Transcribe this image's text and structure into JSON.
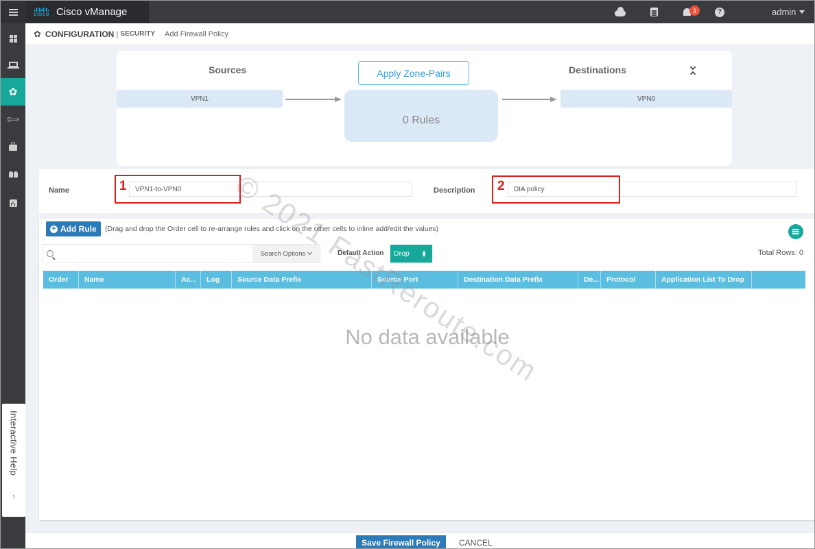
{
  "app": {
    "title": "Cisco vManage",
    "logo_text": "cisco",
    "user": "admin",
    "notification_count": "3",
    "icons": [
      "menu-icon",
      "cloud-icon",
      "clipboard-icon",
      "bell-icon",
      "help-icon"
    ]
  },
  "nav": {
    "items": [
      {
        "name": "dashboard",
        "icon": "grid-icon",
        "active": false
      },
      {
        "name": "monitor",
        "icon": "laptop-icon",
        "active": false
      },
      {
        "name": "configuration",
        "icon": "gear-icon",
        "active": true
      },
      {
        "name": "tools",
        "icon": "wrench-icon",
        "active": false
      },
      {
        "name": "maintenance",
        "icon": "briefcase-icon",
        "active": false
      },
      {
        "name": "administration",
        "icon": "users-icon",
        "active": false
      },
      {
        "name": "analytics",
        "icon": "chart-icon",
        "active": false
      }
    ],
    "help_tab": "Interactive Help",
    "help_chevron": "›"
  },
  "header": {
    "section": "CONFIGURATION",
    "separator": "|",
    "subsection": "SECURITY",
    "page": "Add Firewall Policy"
  },
  "zone": {
    "sources_label": "Sources",
    "destinations_label": "Destinations",
    "apply_button": "Apply Zone-Pairs",
    "source": "VPN1",
    "destination": "VPN0",
    "rules": "0 Rules"
  },
  "form": {
    "name_label": "Name",
    "name_value": "VPN1-to-VPN0",
    "description_label": "Description",
    "description_value": "DIA policy",
    "callout_1": "1",
    "callout_2": "2"
  },
  "rules": {
    "add_button": "Add Rule",
    "hint": "(Drag and drop the Order cell to re-arrange rules and click on the other cells to inline add/edit the values)",
    "search_placeholder": "",
    "search_options": "Search Options",
    "default_action_label": "Default Action",
    "default_action_value": "Drop",
    "total_rows": "Total Rows: 0",
    "columns": [
      "Order",
      "Name",
      "Ac...",
      "Log",
      "Source Data Prefix",
      "Source Port",
      "Destination Data Prefix",
      "De...",
      "Protocol",
      "Application List To Drop",
      ""
    ],
    "empty_text": "No data available"
  },
  "footer": {
    "save": "Save Firewall Policy",
    "cancel": "CANCEL"
  },
  "watermark": "© 2021 FastReroute.com"
}
